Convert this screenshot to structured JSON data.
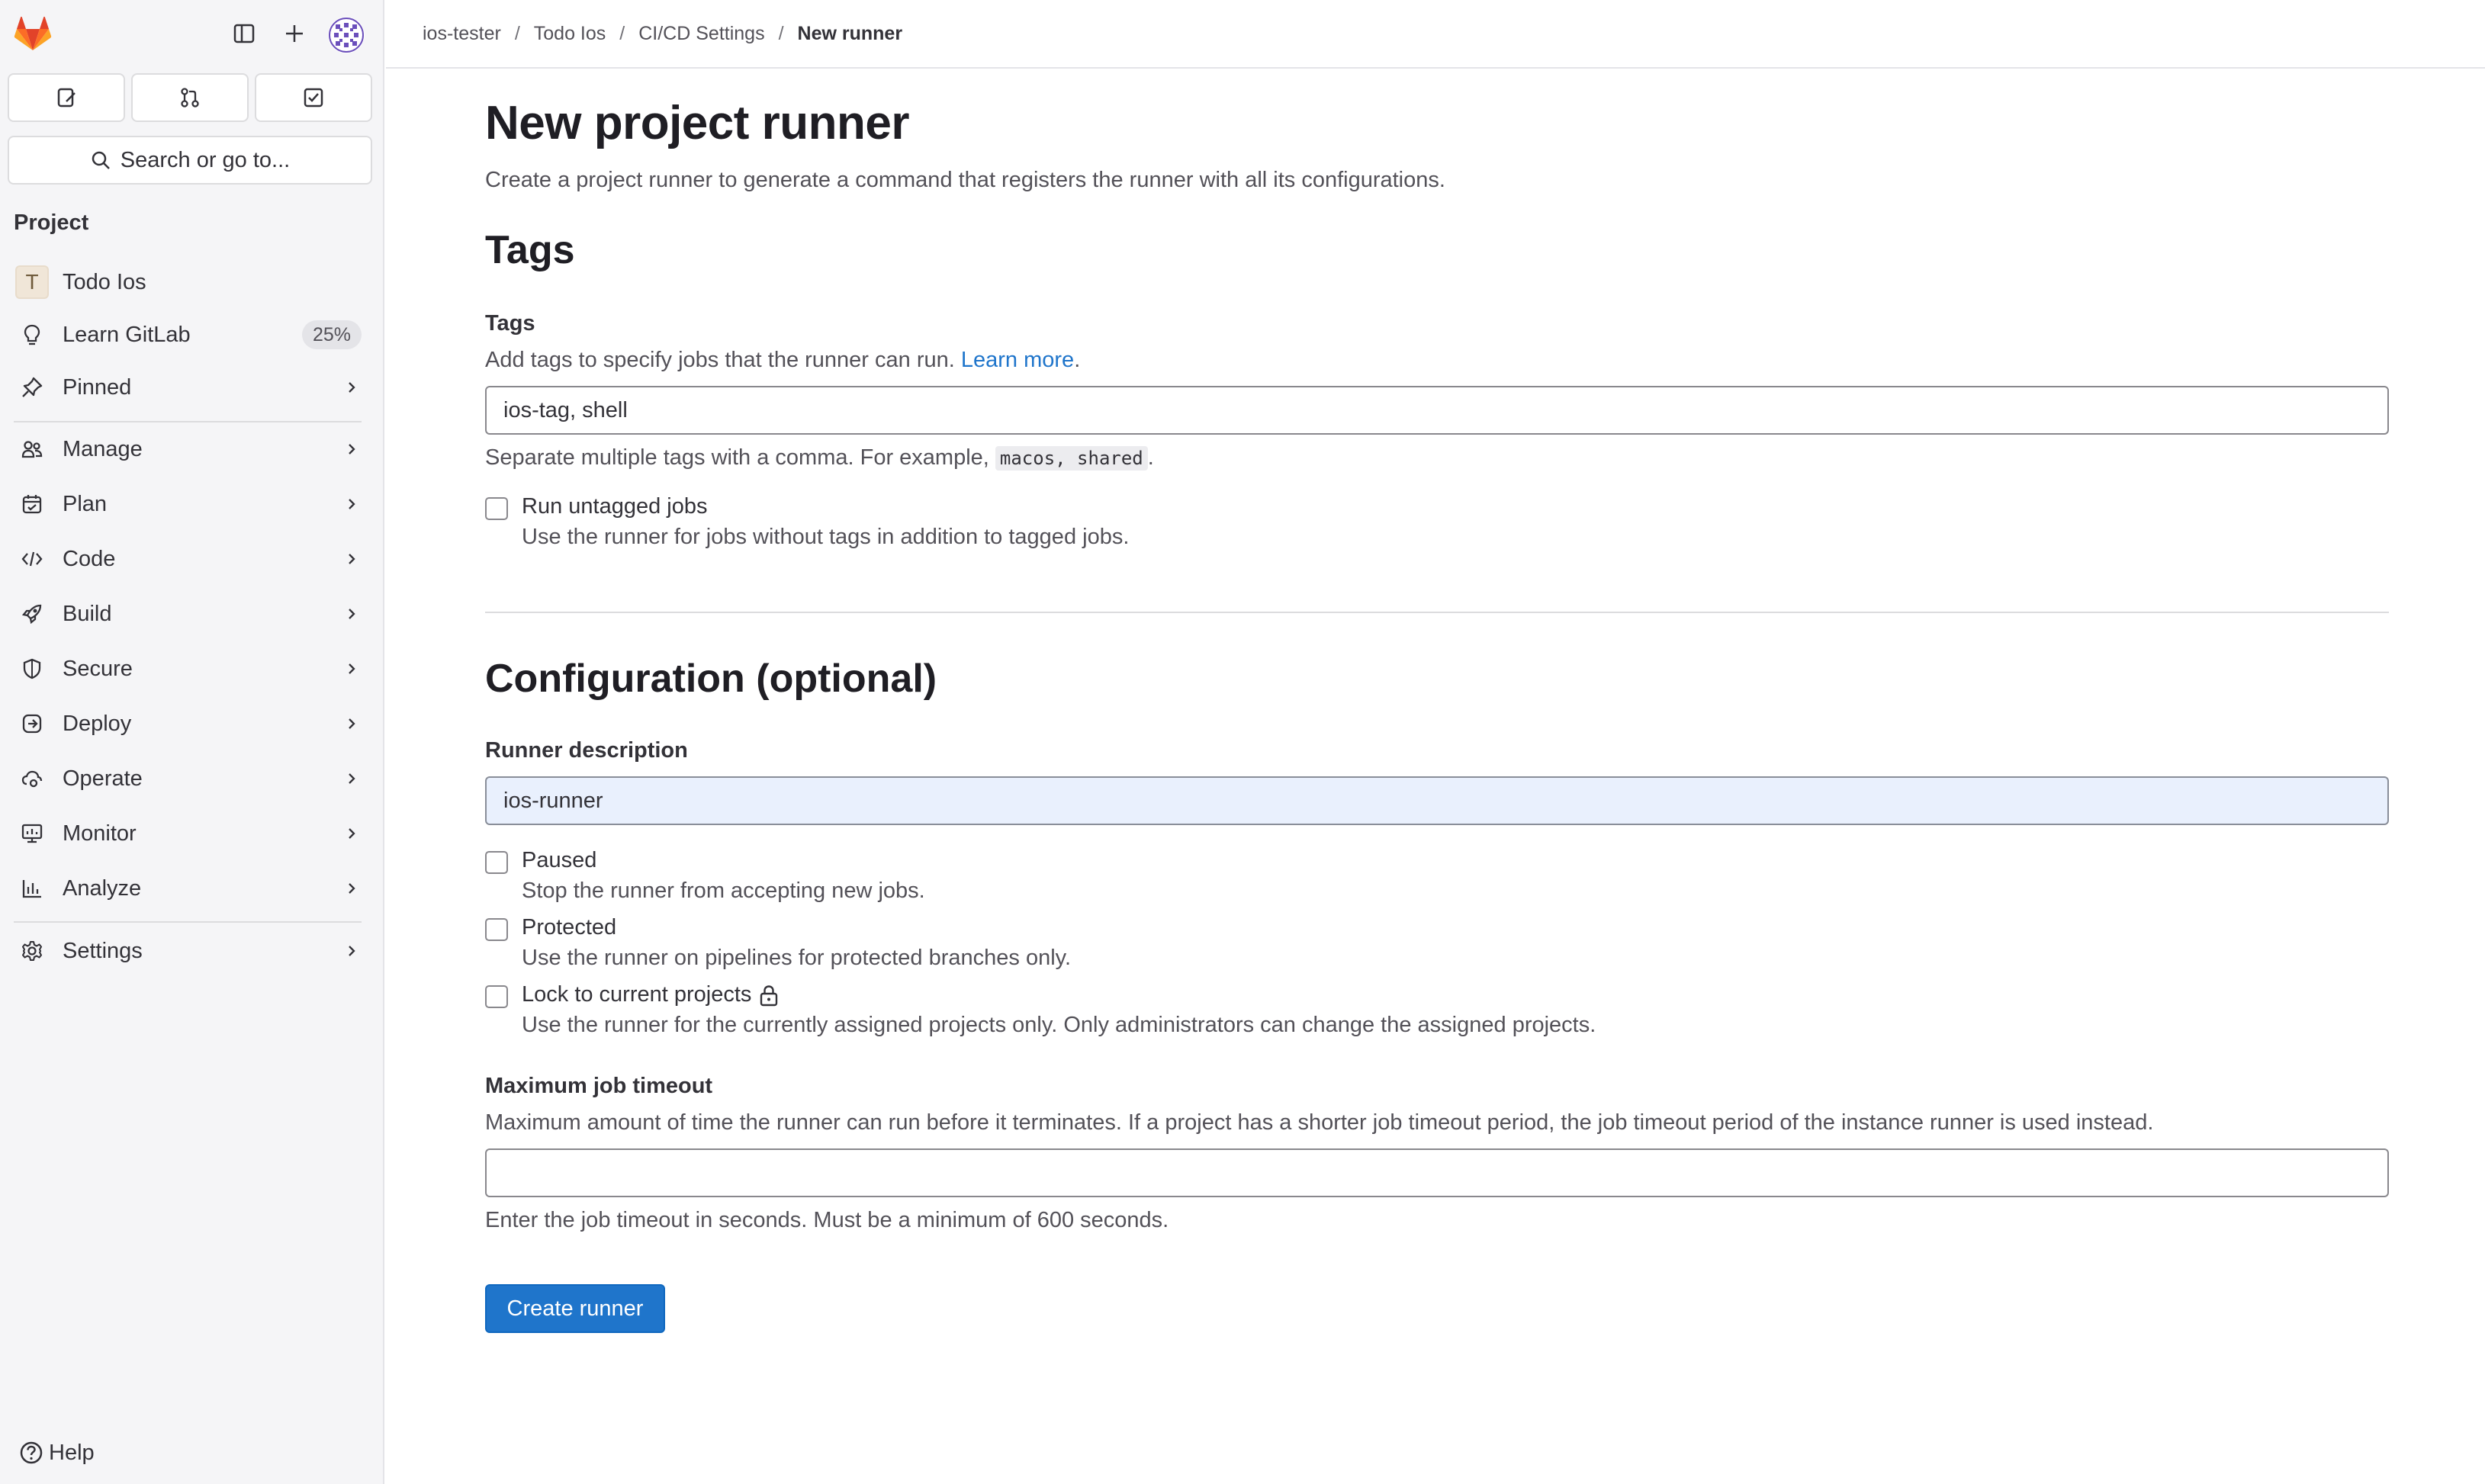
{
  "sidebar": {
    "search_label": "Search or go to...",
    "section_title": "Project",
    "project": {
      "letter": "T",
      "name": "Todo Ios"
    },
    "learn": {
      "label": "Learn GitLab",
      "progress": "25%"
    },
    "pinned": "Pinned",
    "items": [
      {
        "label": "Manage",
        "icon": "users-icon"
      },
      {
        "label": "Plan",
        "icon": "calendar-icon"
      },
      {
        "label": "Code",
        "icon": "code-icon"
      },
      {
        "label": "Build",
        "icon": "rocket-icon"
      },
      {
        "label": "Secure",
        "icon": "shield-icon"
      },
      {
        "label": "Deploy",
        "icon": "deploy-icon"
      },
      {
        "label": "Operate",
        "icon": "cloud-gear-icon"
      },
      {
        "label": "Monitor",
        "icon": "monitor-icon"
      },
      {
        "label": "Analyze",
        "icon": "chart-icon"
      }
    ],
    "settings": "Settings",
    "help": "Help"
  },
  "breadcrumb": {
    "items": [
      "ios-tester",
      "Todo Ios",
      "CI/CD Settings"
    ],
    "current": "New runner"
  },
  "page": {
    "title": "New project runner",
    "description": "Create a project runner to generate a command that registers the runner with all its configurations."
  },
  "tags_section": {
    "heading": "Tags",
    "label": "Tags",
    "help_prefix": "Add tags to specify jobs that the runner can run. ",
    "help_link": "Learn more",
    "help_suffix": ".",
    "value": "ios-tag, shell",
    "hint_prefix": "Separate multiple tags with a comma. For example, ",
    "hint_code": "macos, shared",
    "hint_suffix": ".",
    "untagged": {
      "label": "Run untagged jobs",
      "help": "Use the runner for jobs without tags in addition to tagged jobs.",
      "checked": false
    }
  },
  "config_section": {
    "heading": "Configuration (optional)",
    "description_label": "Runner description",
    "description_value": "ios-runner",
    "paused": {
      "label": "Paused",
      "help": "Stop the runner from accepting new jobs.",
      "checked": false
    },
    "protected": {
      "label": "Protected",
      "help": "Use the runner on pipelines for protected branches only.",
      "checked": false
    },
    "locked": {
      "label": "Lock to current projects",
      "help": "Use the runner for the currently assigned projects only. Only administrators can change the assigned projects.",
      "checked": false
    },
    "timeout_label": "Maximum job timeout",
    "timeout_help": "Maximum amount of time the runner can run before it terminates. If a project has a shorter job timeout period, the job timeout period of the instance runner is used instead.",
    "timeout_value": "",
    "timeout_hint": "Enter the job timeout in seconds. Must be a minimum of 600 seconds."
  },
  "actions": {
    "submit": "Create runner"
  },
  "colors": {
    "primary": "#1f75cb",
    "sidebar_bg": "#f5f5f7",
    "logo_orange": "#e24329"
  }
}
